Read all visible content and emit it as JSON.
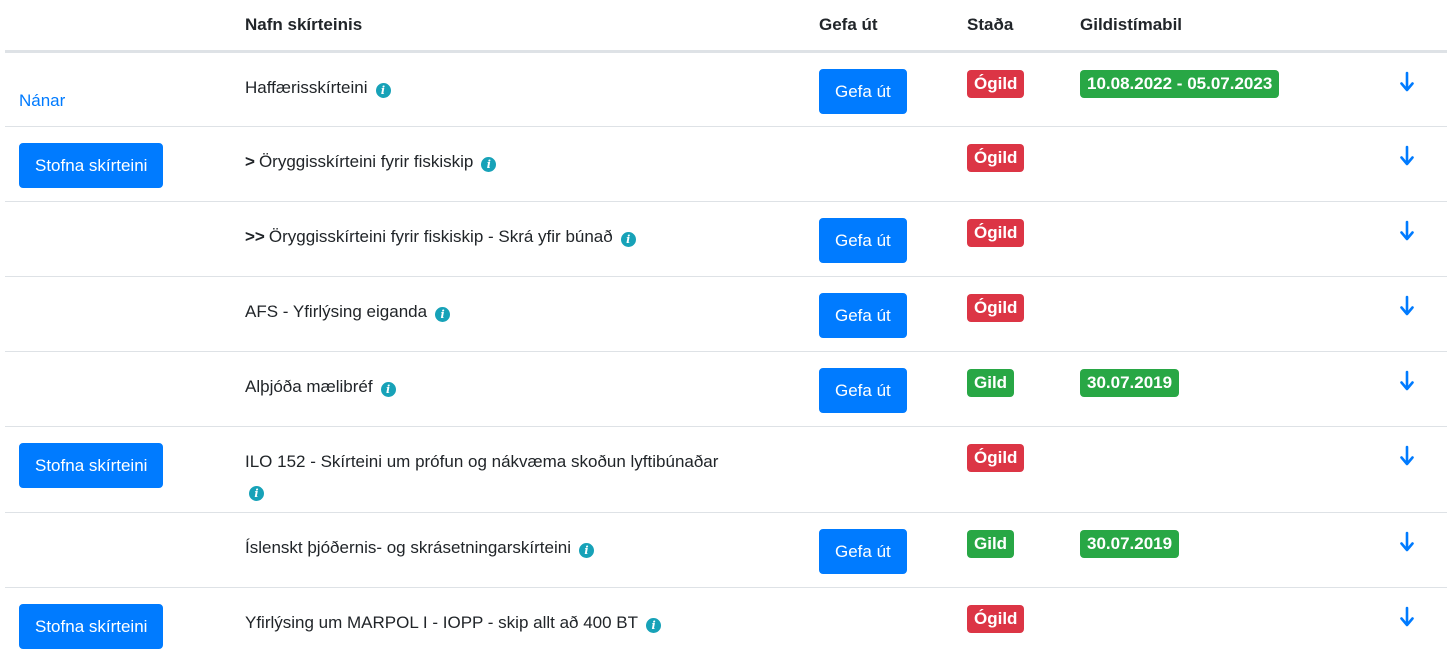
{
  "table": {
    "headers": {
      "action": "",
      "name": "Nafn skírteinis",
      "issue": "Gefa út",
      "status": "Staða",
      "validity": "Gildistímabil"
    },
    "rows": [
      {
        "action_type": "link",
        "action_label": "Nánar",
        "prefix": "",
        "name": "Haffærisskírteini",
        "issue_label": "Gefa út",
        "status": "Ógild",
        "status_color": "#dc3545",
        "validity": "10.08.2022 - 05.07.2023"
      },
      {
        "action_type": "button",
        "action_label": "Stofna skírteini",
        "prefix": ">",
        "name": "Öryggisskírteini fyrir fiskiskip",
        "issue_label": "",
        "status": "Ógild",
        "status_color": "#dc3545",
        "validity": ""
      },
      {
        "action_type": "none",
        "action_label": "",
        "prefix": ">>",
        "name": "Öryggisskírteini fyrir fiskiskip - Skrá yfir búnað",
        "issue_label": "Gefa út",
        "status": "Ógild",
        "status_color": "#dc3545",
        "validity": ""
      },
      {
        "action_type": "none",
        "action_label": "",
        "prefix": "",
        "name": "AFS - Yfirlýsing eiganda",
        "issue_label": "Gefa út",
        "status": "Ógild",
        "status_color": "#dc3545",
        "validity": ""
      },
      {
        "action_type": "none",
        "action_label": "",
        "prefix": "",
        "name": "Alþjóða mælibréf",
        "issue_label": "Gefa út",
        "status": "Gild",
        "status_color": "#28a745",
        "validity": "30.07.2019"
      },
      {
        "action_type": "button",
        "action_label": "Stofna skírteini",
        "prefix": "",
        "name": "ILO 152 - Skírteini um prófun og nákvæma skoðun lyftibúnaðar",
        "issue_label": "",
        "status": "Ógild",
        "status_color": "#dc3545",
        "validity": ""
      },
      {
        "action_type": "none",
        "action_label": "",
        "prefix": "",
        "name": "Íslenskt þjóðernis- og skrásetningarskírteini",
        "issue_label": "Gefa út",
        "status": "Gild",
        "status_color": "#28a745",
        "validity": "30.07.2019"
      },
      {
        "action_type": "button",
        "action_label": "Stofna skírteini",
        "prefix": "",
        "name": "Yfirlýsing um MARPOL I - IOPP - skip allt að 400 BT",
        "issue_label": "",
        "status": "Ógild",
        "status_color": "#dc3545",
        "validity": ""
      }
    ]
  },
  "icons": {
    "info": "info-icon",
    "download": "download-arrow-icon"
  },
  "colors": {
    "primary": "#007bff",
    "danger": "#dc3545",
    "success": "#28a745",
    "info": "#17a2b8"
  }
}
